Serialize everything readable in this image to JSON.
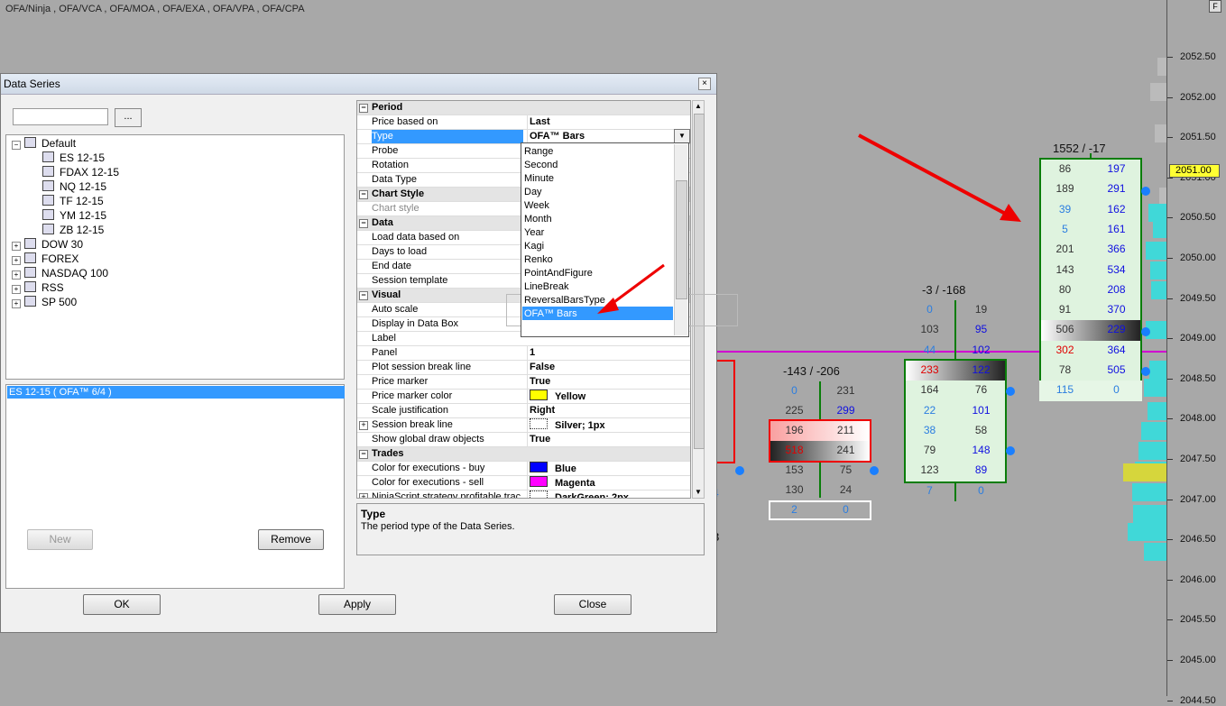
{
  "chart": {
    "title": "OFA/Ninja , OFA/VCA , OFA/MOA , OFA/EXA , OFA/VPA , OFA/CPA",
    "corner": "F",
    "price_labels": [
      "2052.50",
      "2052.00",
      "2051.50",
      "2051.00",
      "2050.50",
      "2050.00",
      "2049.50",
      "2049.00",
      "2048.50",
      "2048.00",
      "2047.50",
      "2047.00",
      "2046.50",
      "2046.00",
      "2045.50",
      "2045.00",
      "2044.50"
    ],
    "current_price": "2051.00",
    "bars": [
      {
        "header_left": "-143",
        "header_sep": "/",
        "header_right": "-206",
        "cells": [
          [
            "0",
            "231"
          ],
          [
            "225",
            "299"
          ],
          [
            "196",
            "211"
          ],
          [
            "518",
            "241"
          ],
          [
            "153",
            "75"
          ],
          [
            "130",
            "24"
          ],
          [
            "2",
            "0"
          ]
        ]
      },
      {
        "header_left": "-3",
        "header_sep": "/",
        "header_right": "-168",
        "cells": [
          [
            "0",
            "19"
          ],
          [
            "103",
            "95"
          ],
          [
            "44",
            "102"
          ],
          [
            "233",
            "122"
          ],
          [
            "164",
            "76"
          ],
          [
            "22",
            "101"
          ],
          [
            "38",
            "58"
          ],
          [
            "79",
            "148"
          ],
          [
            "123",
            "89"
          ],
          [
            "7",
            "0"
          ]
        ]
      },
      {
        "header_left": "1552",
        "header_sep": "/",
        "header_right": "-17",
        "cells": [
          [
            "86",
            "197"
          ],
          [
            "189",
            "291"
          ],
          [
            "39",
            "162"
          ],
          [
            "5",
            "161"
          ],
          [
            "201",
            "366"
          ],
          [
            "143",
            "534"
          ],
          [
            "80",
            "208"
          ],
          [
            "91",
            "370"
          ],
          [
            "506",
            "229"
          ],
          [
            "302",
            "364"
          ],
          [
            "78",
            "505"
          ],
          [
            "115",
            "0"
          ]
        ]
      }
    ],
    "partial_digit": "8",
    "partial_digit2": "4"
  },
  "dialog": {
    "title": "Data Series",
    "close": "×",
    "browse": "...",
    "tree": [
      {
        "label": "Default",
        "level": 0,
        "expanded": true
      },
      {
        "label": "ES 12-15",
        "level": 1
      },
      {
        "label": "FDAX 12-15",
        "level": 1
      },
      {
        "label": "NQ 12-15",
        "level": 1
      },
      {
        "label": "TF 12-15",
        "level": 1
      },
      {
        "label": "YM 12-15",
        "level": 1
      },
      {
        "label": "ZB 12-15",
        "level": 1
      },
      {
        "label": "DOW 30",
        "level": 0
      },
      {
        "label": "FOREX",
        "level": 0
      },
      {
        "label": "NASDAQ 100",
        "level": 0
      },
      {
        "label": "RSS",
        "level": 0
      },
      {
        "label": "SP 500",
        "level": 0
      }
    ],
    "selected_series": "ES 12-15 ( OFA™ 6/4 )",
    "buttons": {
      "new": "New",
      "remove": "Remove",
      "ok": "OK",
      "apply": "Apply",
      "close": "Close"
    },
    "properties": [
      {
        "cat": "Period"
      },
      {
        "name": "Price based on",
        "value": "Last"
      },
      {
        "name": "Type",
        "value": "OFA™ Bars",
        "selected": true
      },
      {
        "name": "Probe",
        "value": ""
      },
      {
        "name": "Rotation",
        "value": ""
      },
      {
        "name": "Data Type",
        "value": ""
      },
      {
        "cat": "Chart Style"
      },
      {
        "name": "Chart style",
        "value": "",
        "disabled": true
      },
      {
        "cat": "Data"
      },
      {
        "name": "Load data based on",
        "value": ""
      },
      {
        "name": "Days to load",
        "value": ""
      },
      {
        "name": "End date",
        "value": ""
      },
      {
        "name": "Session template",
        "value": ""
      },
      {
        "cat": "Visual"
      },
      {
        "name": "Auto scale",
        "value": ""
      },
      {
        "name": "Display in Data Box",
        "value": ""
      },
      {
        "name": "Label",
        "value": ""
      },
      {
        "name": "Panel",
        "value": "1"
      },
      {
        "name": "Plot session break line",
        "value": "False"
      },
      {
        "name": "Price marker",
        "value": "True"
      },
      {
        "name": "Price marker color",
        "value": "Yellow",
        "swatch": "#ffff00"
      },
      {
        "name": "Scale justification",
        "value": "Right"
      },
      {
        "name": "Session break line",
        "value": "Silver; 1px",
        "line": true,
        "expander": true
      },
      {
        "name": "Show global draw objects",
        "value": "True"
      },
      {
        "cat": "Trades"
      },
      {
        "name": "Color for executions - buy",
        "value": "Blue",
        "swatch": "#0000ff"
      },
      {
        "name": "Color for executions - sell",
        "value": "Magenta",
        "swatch": "#ff00ff"
      },
      {
        "name": "NinjaScript strategy profitable trac",
        "value": "DarkGreen; 2px",
        "line": true,
        "expander": true
      }
    ],
    "dropdown": [
      "Range",
      "Second",
      "Minute",
      "Day",
      "Week",
      "Month",
      "Year",
      "Kagi",
      "Renko",
      "PointAndFigure",
      "LineBreak",
      "ReversalBarsType",
      "OFA™ Bars"
    ],
    "description": {
      "title": "Type",
      "text": "The period type of the Data Series."
    }
  }
}
